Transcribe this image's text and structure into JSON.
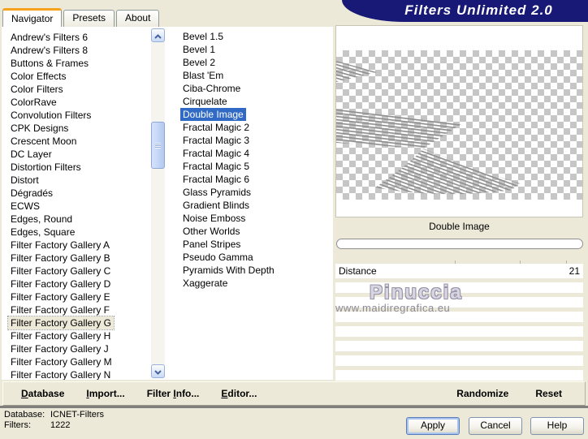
{
  "window": {
    "title": "Filters Unlimited 2.0"
  },
  "tabs": [
    {
      "label": "Navigator",
      "selected": true
    },
    {
      "label": "Presets"
    },
    {
      "label": "About"
    }
  ],
  "category_list": {
    "items": [
      {
        "label": "Andrew's Filters 6"
      },
      {
        "label": "Andrew's Filters 8"
      },
      {
        "label": "Buttons & Frames"
      },
      {
        "label": "Color Effects"
      },
      {
        "label": "Color Filters"
      },
      {
        "label": "ColorRave"
      },
      {
        "label": "Convolution Filters"
      },
      {
        "label": "CPK Designs"
      },
      {
        "label": "Crescent Moon"
      },
      {
        "label": "DC Layer"
      },
      {
        "label": "Distortion Filters"
      },
      {
        "label": "Distort"
      },
      {
        "label": "Dégradés"
      },
      {
        "label": "ECWS"
      },
      {
        "label": "Edges, Round"
      },
      {
        "label": "Edges, Square"
      },
      {
        "label": "Filter Factory Gallery A"
      },
      {
        "label": "Filter Factory Gallery B"
      },
      {
        "label": "Filter Factory Gallery C"
      },
      {
        "label": "Filter Factory Gallery D"
      },
      {
        "label": "Filter Factory Gallery E"
      },
      {
        "label": "Filter Factory Gallery F"
      },
      {
        "label": "Filter Factory Gallery G",
        "selected": true
      },
      {
        "label": "Filter Factory Gallery H"
      },
      {
        "label": "Filter Factory Gallery J"
      },
      {
        "label": "Filter Factory Gallery M"
      },
      {
        "label": "Filter Factory Gallery N"
      }
    ]
  },
  "filter_list": {
    "items": [
      {
        "label": "Bevel 1.5"
      },
      {
        "label": "Bevel 1"
      },
      {
        "label": "Bevel 2"
      },
      {
        "label": "Blast 'Em"
      },
      {
        "label": "Ciba-Chrome"
      },
      {
        "label": "Cirquelate"
      },
      {
        "label": "Double Image",
        "selected": true
      },
      {
        "label": "Fractal Magic 2"
      },
      {
        "label": "Fractal Magic 3"
      },
      {
        "label": "Fractal Magic 4"
      },
      {
        "label": "Fractal Magic 5"
      },
      {
        "label": "Fractal Magic 6"
      },
      {
        "label": "Glass Pyramids"
      },
      {
        "label": "Gradient Blinds"
      },
      {
        "label": "Noise Emboss"
      },
      {
        "label": "Other Worlds"
      },
      {
        "label": "Panel Stripes"
      },
      {
        "label": "Pseudo Gamma"
      },
      {
        "label": "Pyramids With Depth"
      },
      {
        "label": "Xaggerate"
      }
    ]
  },
  "preview": {
    "filter_name": "Double Image"
  },
  "controls": {
    "sliders": [
      {
        "label": "Distance",
        "value": "21"
      }
    ]
  },
  "watermark": {
    "line1": "Pinuccia",
    "line2": "www.maidiregrafica.eu"
  },
  "toolbar": {
    "left_items": [
      {
        "pre": "",
        "key": "D",
        "rest": "atabase"
      },
      {
        "pre": "",
        "key": "I",
        "rest": "mport..."
      },
      {
        "pre": "Filter ",
        "key": "I",
        "rest": "nfo..."
      },
      {
        "pre": "",
        "key": "E",
        "rest": "ditor..."
      }
    ],
    "right_items": [
      {
        "pre": "",
        "key": "",
        "rest": "Randomize"
      },
      {
        "pre": "",
        "key": "",
        "rest": "Reset"
      }
    ]
  },
  "status": [
    {
      "label": "Database:",
      "value": "ICNET-Filters"
    },
    {
      "label": "Filters:",
      "value": "1222"
    }
  ],
  "action_buttons": {
    "apply": "Apply",
    "cancel": "Cancel",
    "help": "Help"
  },
  "colors": {
    "dialog_background": "#ece9d8",
    "banner_navy": "#181877",
    "tab_accent_orange": "#f7a21f",
    "selection_blue": "#316ac5",
    "checker_gray": "#c6c6c6",
    "ribbon_gray": "#8f8f8f"
  }
}
